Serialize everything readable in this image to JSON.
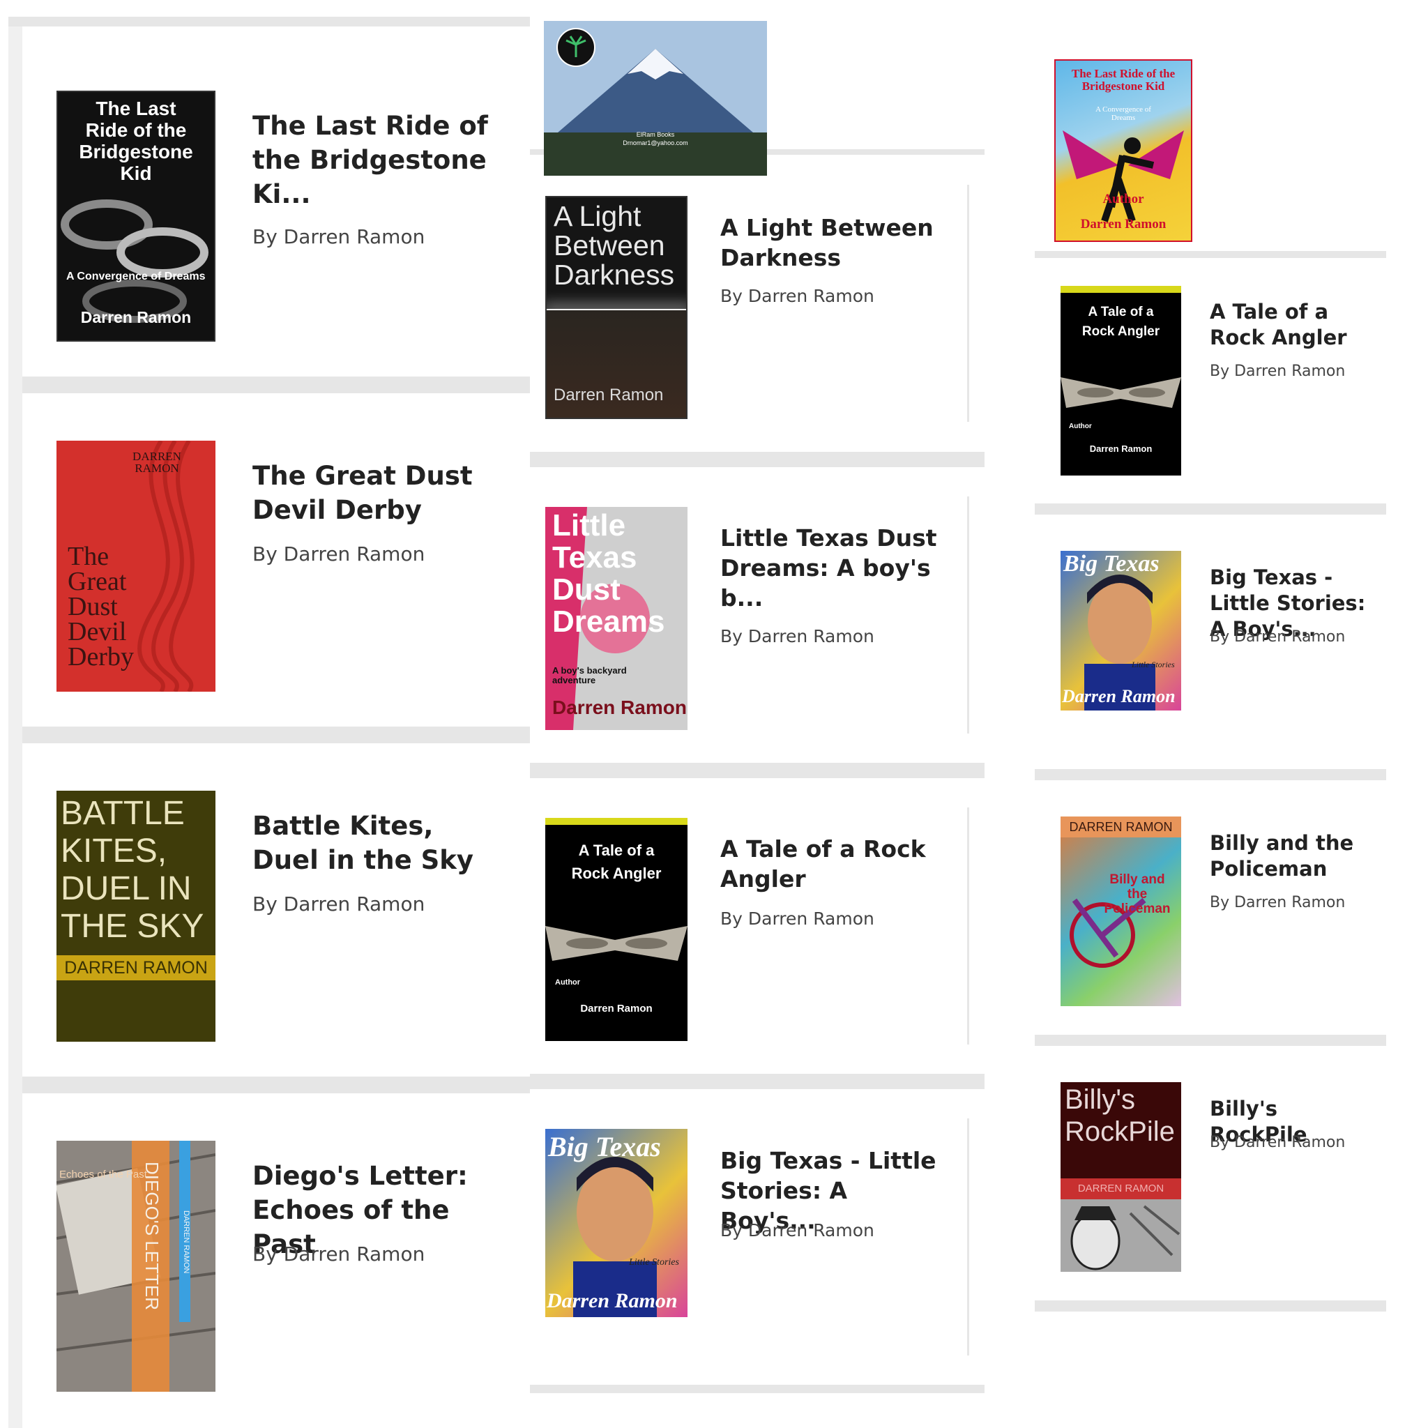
{
  "author_line": "By Darren Ramon",
  "logo_text": "ElRam Books",
  "logo_email": "Drnomar1@yahoo.com",
  "column1": [
    {
      "title": "The Last Ride of the Bridgestone Ki...",
      "cover_lines": [
        "The Last",
        "Ride of the",
        "Bridgestone",
        "Kid"
      ],
      "cover_sub": "A Convergence of Dreams",
      "cover_author": "Darren Ramon"
    },
    {
      "title": "The Great Dust Devil Derby",
      "cover_top": "DARREN RAMON",
      "cover_lines": [
        "The",
        "Great",
        "Dust",
        "Devil",
        "Derby"
      ]
    },
    {
      "title": "Battle Kites, Duel in the Sky",
      "cover_lines": [
        "BATTLE",
        "KITES,",
        "DUEL IN",
        "THE SKY"
      ],
      "cover_author": "DARREN RAMON"
    },
    {
      "title": "Diego's Letter: Echoes of the Past",
      "cover_top": "Echoes of the Past",
      "cover_spine": "DIEGO'S LETTER",
      "cover_author": "DARREN RAMON"
    }
  ],
  "column2": [
    {
      "title": "A Light Between Darkness",
      "cover_lines": [
        "A Light",
        "Between",
        "Darkness"
      ],
      "cover_author": "Darren Ramon"
    },
    {
      "title": "Little Texas Dust Dreams: A boy's b...",
      "cover_lines": [
        "Little",
        "Texas",
        "Dust",
        "Dreams"
      ],
      "cover_sub": "A boy's backyard adventure",
      "cover_author": "Darren Ramon"
    },
    {
      "title": "A Tale of a Rock Angler",
      "cover_lines": [
        "A Tale of a",
        "Rock Angler"
      ],
      "cover_label": "Author",
      "cover_author": "Darren Ramon"
    },
    {
      "title": "Big Texas - Little Stories: A Boy's...",
      "cover_top": "Big Texas",
      "cover_sub": "Little Stories",
      "cover_author": "Darren Ramon"
    }
  ],
  "column3": [
    {
      "title": "",
      "cover_lines": [
        "The Last Ride of the",
        "Bridgestone Kid"
      ],
      "cover_sub": "A Convergence of Dreams",
      "cover_label": "Author",
      "cover_author": "Darren Ramon"
    },
    {
      "title": "A Tale of a Rock Angler",
      "cover_lines": [
        "A Tale of a",
        "Rock Angler"
      ],
      "cover_label": "Author",
      "cover_author": "Darren Ramon"
    },
    {
      "title": "Big Texas - Little Stories: A Boy's...",
      "cover_top": "Big Texas",
      "cover_sub": "Little Stories",
      "cover_author": "Darren Ramon"
    },
    {
      "title": "Billy and the Policeman",
      "cover_top": "DARREN RAMON",
      "cover_lines": [
        "Billy and",
        "the",
        "Policeman"
      ]
    },
    {
      "title": "Billy's RockPile",
      "cover_lines": [
        "Billy's",
        "RockPile"
      ],
      "cover_author": "DARREN RAMON"
    }
  ]
}
